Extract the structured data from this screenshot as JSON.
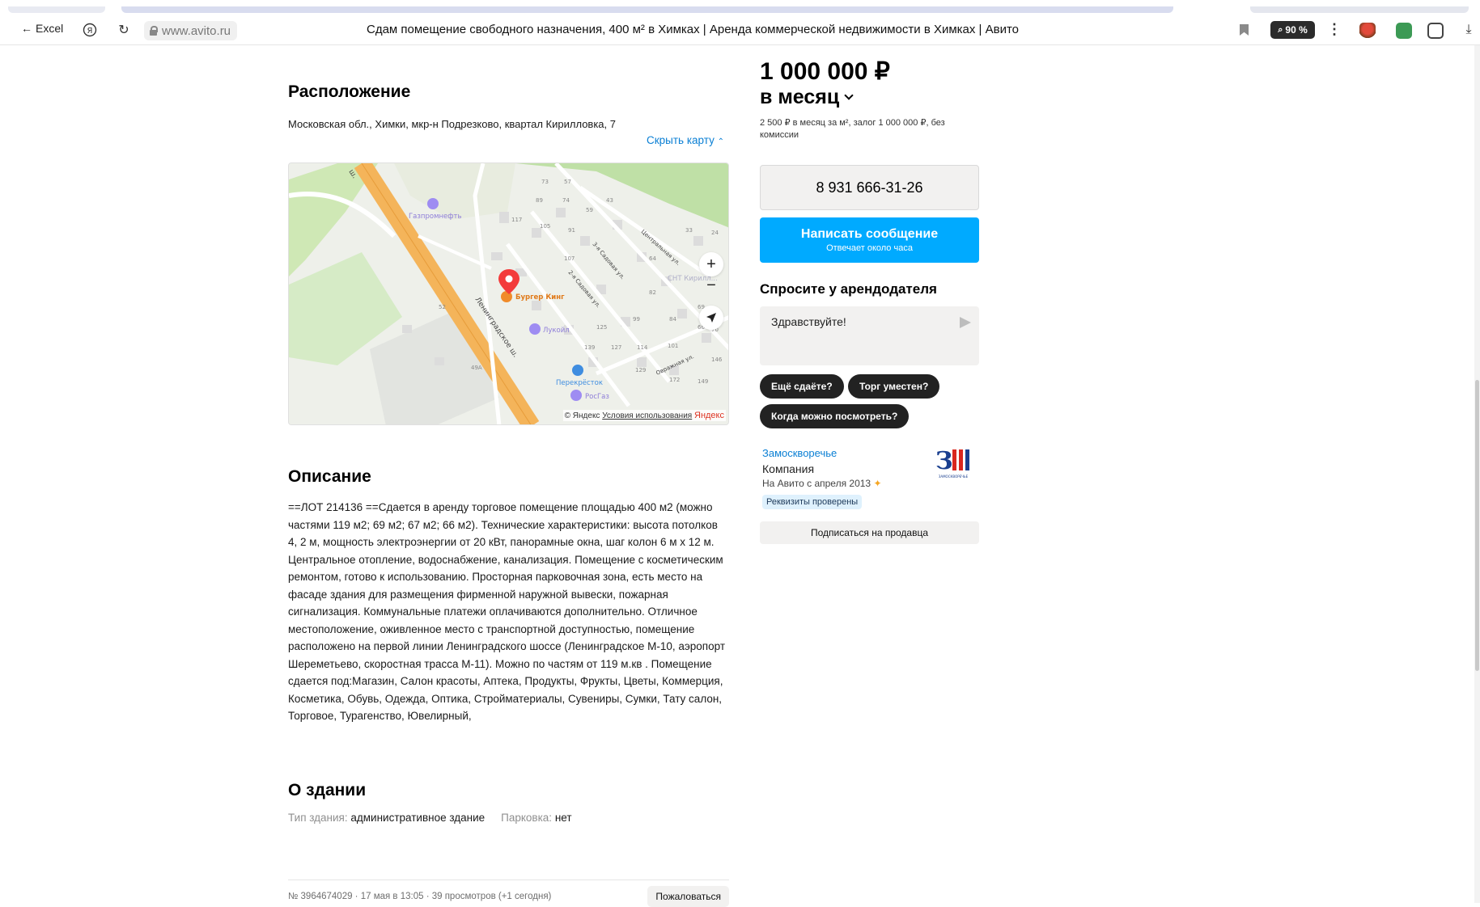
{
  "browser": {
    "back_label": "Excel",
    "url_domain": "www.avito.ru",
    "tab_title": "Сдам помещение свободного назначения, 400 м² в Химках | Аренда коммерческой недвижимости в Химках | Авито",
    "zoom_label": "90 %"
  },
  "location": {
    "title": "Расположение",
    "address": "Московская обл., Химки, мкр-н Подрезково, квартал Кирилловка, 7",
    "hide_map_label": "Скрыть карту",
    "map": {
      "street_main": "Ленинградское ш.",
      "street_main_short": "ш.",
      "street_1": "3-я Садовая ул.",
      "street_2": "2-я Садовая ул.",
      "street_3": "Центральная ул.",
      "street_4": "Овражная ул.",
      "poi_1": "Газпромнефть",
      "poi_2": "Бургер Кинг",
      "poi_3": "Лукойл",
      "poi_4": "Перекрёсток",
      "poi_5": "РосГаз",
      "poi_6": "СНТ Кирилл...",
      "house_numbers": [
        "73",
        "57",
        "89",
        "74",
        "43",
        "117",
        "105",
        "91",
        "59",
        "33",
        "24",
        "107",
        "64",
        "82",
        "69",
        "52",
        "99",
        "125",
        "84",
        "66",
        "70",
        "139",
        "127",
        "114",
        "101",
        "146",
        "129",
        "172",
        "149",
        "49А"
      ],
      "zoom_in": "+",
      "zoom_out": "−",
      "copyright": "© Яндекс",
      "terms": "Условия использования",
      "brand": "Яндекс"
    }
  },
  "description": {
    "title": "Описание",
    "text": "==ЛОТ 214136 ==Сдается в аренду торговое помещение площадью 400 м2 (можно частями 119 м2; 69 м2; 67 м2; 66 м2). Технические характеристики: высота потолков 4, 2 м, мощность электроэнергии от 20 кВт, панорамные окна, шаг колон 6 м х 12 м. Центральное отопление, водоснабжение, канализация. Помещение с косметическим ремонтом, готово к использованию. Просторная парковочная зона, есть место на фасаде здания для размещения фирменной наружной вывески, пожарная сигнализация. Коммунальные платежи оплачиваются дополнительно. Отличное местоположение, оживленное место с транспортной доступностью, помещение расположено на первой линии Ленинградского шоссе (Ленинградское М-10, аэропорт Шереметьево, скоростная трасса М-11). Можно по частям от 119 м.кв . Помещение сдается под:Магазин, Салон красоты, Аптека, Продукты, Фрукты, Цветы, Коммерция, Косметика, Обувь, Одежда, Оптика, Стройматериалы, Сувениры, Сумки, Тату салон, Торговое, Турагенство, Ювелирный,"
  },
  "building": {
    "title": "О здании",
    "type_label": "Тип здания:",
    "type_value": "административное здание",
    "parking_label": "Парковка:",
    "parking_value": "нет"
  },
  "footer": {
    "meta": "№ 3964674029 · 17 мая в 13:05 · 39 просмотров (+1 сегодня)",
    "complain_label": "Пожаловаться"
  },
  "sidebar": {
    "price": "1 000 000 ₽",
    "period": "в месяц",
    "price_details": "2 500 ₽ в месяц за м², залог 1 000 000 ₽, без комиссии",
    "phone": "8 931 666-31-26",
    "message_button": "Написать сообщение",
    "message_sub": "Отвечает около часа",
    "ask_title": "Спросите у арендодателя",
    "ask_placeholder": "Здравствуйте!",
    "chips": [
      "Ещё сдаёте?",
      "Торг уместен?",
      "Когда можно посмотреть?"
    ],
    "seller_name": "Замоскворечье",
    "seller_type": "Компания",
    "seller_since": "На Авито с апреля 2013",
    "verified": "Реквизиты проверены",
    "subscribe": "Подписаться на продавца",
    "logo_text": "ЗАМОСКВОРЕЧЬЕ"
  },
  "colors": {
    "accent_blue": "#00aaff",
    "link_blue": "#0a7fd4",
    "map_road": "#f4b45a",
    "pin_red": "#f33b3b"
  }
}
